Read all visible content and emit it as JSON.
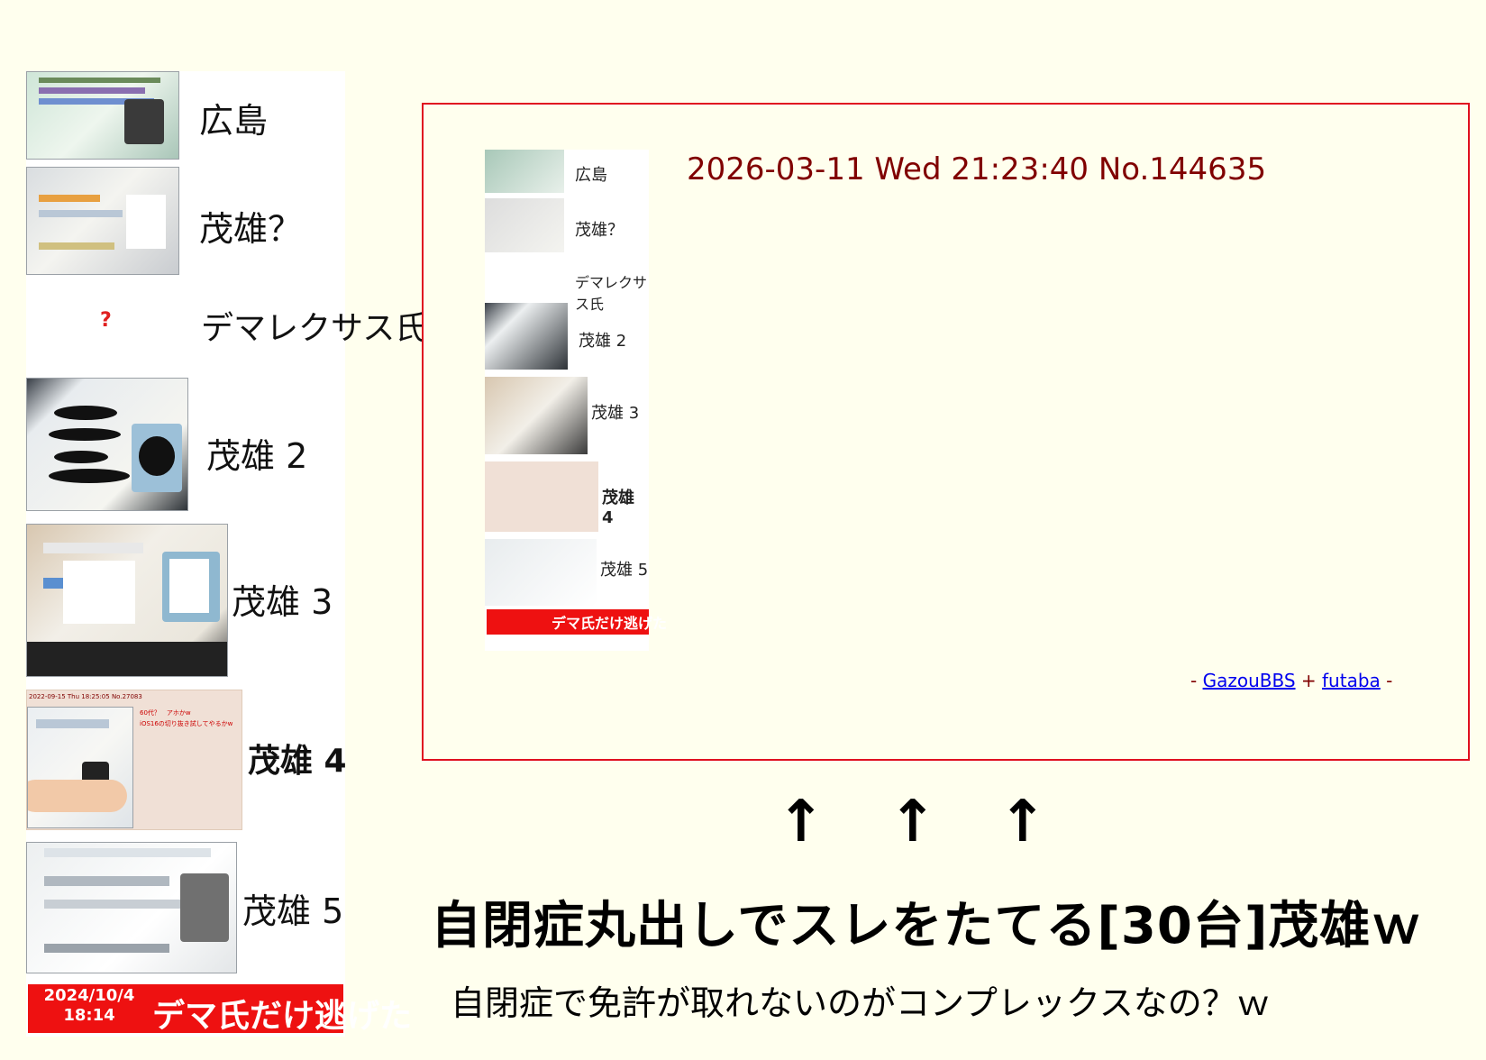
{
  "collage": {
    "rows": [
      {
        "label": "広島"
      },
      {
        "label": "茂雄？"
      },
      {
        "label": "デマレクサス氏",
        "placeholder_icon": "?"
      },
      {
        "label": "茂雄 2"
      },
      {
        "label": "茂雄 3"
      },
      {
        "label": "茂雄 4"
      },
      {
        "label": "茂雄 5"
      }
    ],
    "sub_post": {
      "header": "2022-09-15 Thu 18:25:05 No.27083",
      "line1": "60代？　アホかw",
      "line2": "iOS16の切り抜き試してやるかw"
    },
    "banner": {
      "date": "2024/10/4",
      "time": "18:14",
      "text": "デマ氏だけ逃げた"
    }
  },
  "panel": {
    "post_header": "2026-03-11 Wed 21:23:40 No.144635",
    "footer": {
      "prefix": "- ",
      "link1": "GazouBBS",
      "sep": " + ",
      "link2": "futaba",
      "suffix": " -"
    },
    "mini_labels": [
      "広島",
      "茂雄？",
      "デマレクサス氏",
      "茂雄 2",
      "茂雄 3",
      "茂雄 4",
      "茂雄 5"
    ],
    "mini_banner": "デマ氏だけ逃げた"
  },
  "arrows": [
    "↑",
    "↑",
    "↑"
  ],
  "headline": "自閉症丸出しでスレをたてる[30台]茂雄ｗ",
  "subline": "自閉症で免許が取れないのがコンプレックスなの？ｗ"
}
